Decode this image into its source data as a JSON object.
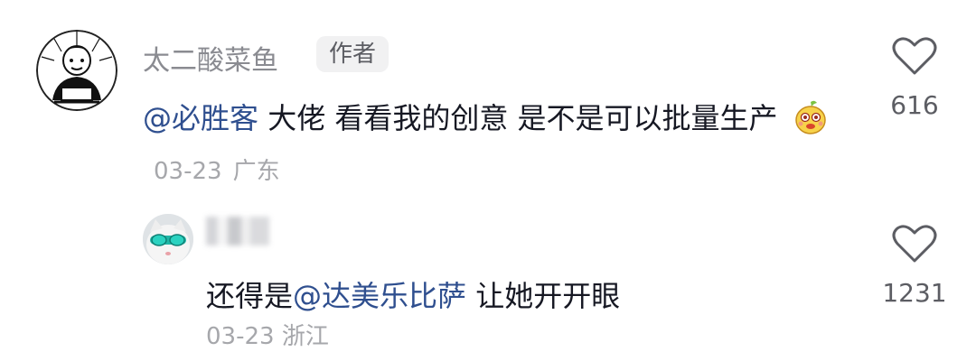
{
  "comments": [
    {
      "username": "太二酸菜鱼",
      "author_tag": "作者",
      "mention": "@必胜客",
      "text": " 大佬 看看我的创意 是不是可以批量生产",
      "date": "03-23",
      "location": "广东",
      "likes": "616"
    },
    {
      "text_prefix": "还得是",
      "mention": "@达美乐比萨",
      "text_suffix": " 让她开开眼",
      "date": "03-23",
      "location": "浙江",
      "likes": "1231"
    }
  ]
}
